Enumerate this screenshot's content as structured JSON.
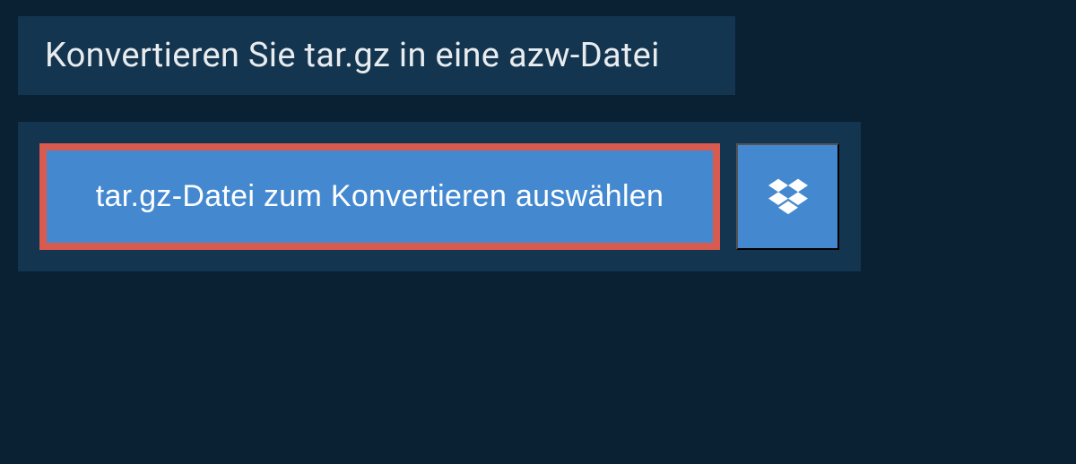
{
  "header": {
    "title": "Konvertieren Sie tar.gz in eine azw-Datei"
  },
  "buttons": {
    "select_file_label": "tar.gz-Datei zum Konvertieren auswählen"
  },
  "colors": {
    "background": "#0a2033",
    "panel": "#14354f",
    "primary_button": "#4489d0",
    "highlight_border": "#d95a4e"
  }
}
